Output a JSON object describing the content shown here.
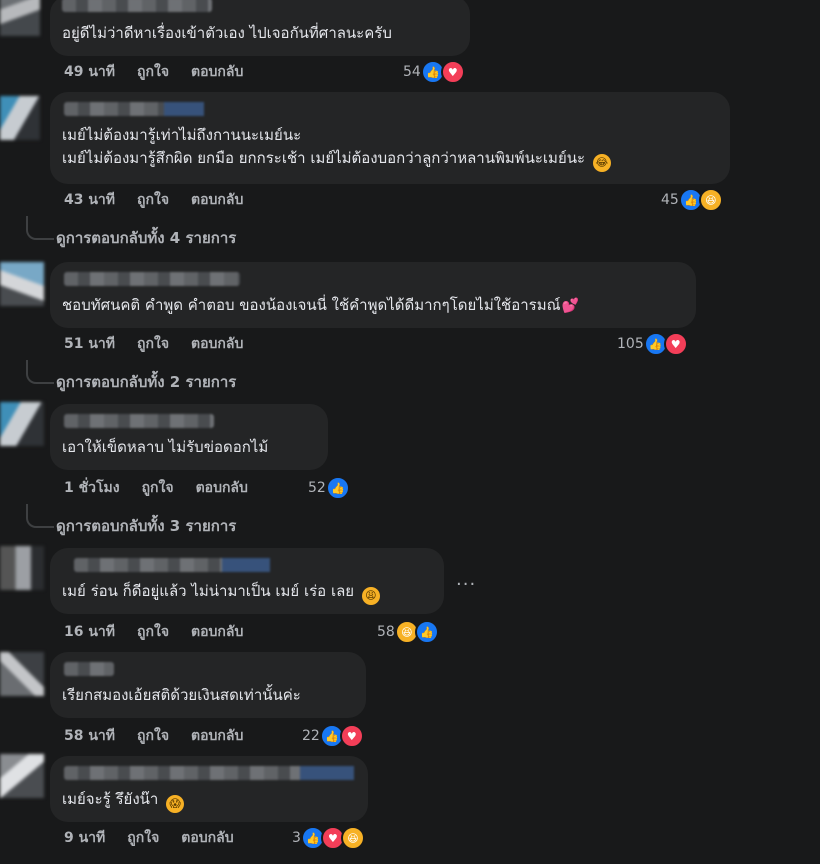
{
  "labels": {
    "like": "ถูกใจ",
    "reply": "ตอบกลับ"
  },
  "comments": [
    {
      "text": [
        "อยู่ดีไม่ว่าดีหาเรื่องเข้าตัวเอง ไปเจอกันที่ศาลนะครับ"
      ],
      "time": "49 นาที",
      "count": "54",
      "reactions": [
        "like-icon",
        "love-icon"
      ]
    },
    {
      "text": [
        "เมย์ไม่ต้องมารู้เท่าไม่ถึงกานนะเมย์นะ",
        "เมย์ไม่ต้องมารู้สึกผิด ยกมือ ยกกระเช้า เมย์ไม่ต้องบอกว่าลูกว่าหลานพิมพ์นะเมย์นะ"
      ],
      "time": "43 นาที",
      "count": "45",
      "reactions": [
        "like-icon",
        "haha-icon"
      ],
      "view_more": "ดูการตอบกลับทั้ง 4 รายการ"
    },
    {
      "text": [
        "ชอบทัศนคติ คำพูด คำตอบ ของน้องเจนนี่ ใช้คำพูดได้ดีมากๆโดยไม่ใช้อารมณ์"
      ],
      "time": "51 นาที",
      "count": "105",
      "reactions": [
        "like-icon",
        "love-icon"
      ],
      "view_more": "ดูการตอบกลับทั้ง 2 รายการ"
    },
    {
      "text": [
        "เอาให้เข็ดหลาบ ไม่รับข่อดอกไม้"
      ],
      "time": "1 ชั่วโมง",
      "count": "52",
      "reactions": [
        "like-icon"
      ],
      "view_more": "ดูการตอบกลับทั้ง 3 รายการ"
    },
    {
      "text": [
        "เมย์ ร่อน ก็ดีอยู่แล้ว ไม่น่ามาเป็น เมย์ เร่อ เลย"
      ],
      "time": "16 นาที",
      "count": "58",
      "reactions": [
        "haha-icon",
        "like-icon"
      ]
    },
    {
      "text": [
        "เรียกสมองเอ้ยสติด้วยเงินสดเท่านั้นค่ะ"
      ],
      "time": "58 นาที",
      "count": "22",
      "reactions": [
        "like-icon",
        "love-icon"
      ]
    },
    {
      "text": [
        "เมย์จะรู้ รึยังน๊า"
      ],
      "time": "9 นาที",
      "count": "3",
      "reactions": [
        "like-icon",
        "love-icon",
        "haha-icon"
      ]
    }
  ],
  "more_options": "···"
}
